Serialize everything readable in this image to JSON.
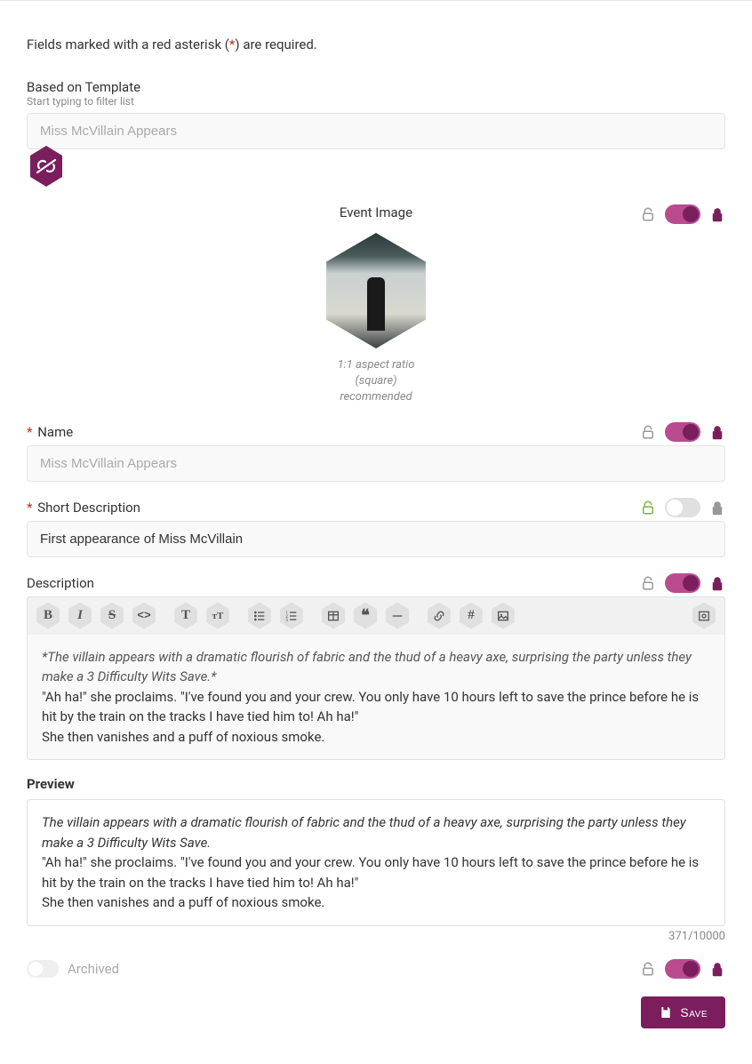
{
  "required_notice_pre": "Fields marked with a red asterisk (",
  "required_notice_mark": "*",
  "required_notice_post": ") are required.",
  "template": {
    "label": "Based on Template",
    "sublabel": "Start typing to filter list",
    "value": "Miss McVillain Appears"
  },
  "image": {
    "label": "Event Image",
    "hint_line1": "1:1 aspect ratio",
    "hint_line2": "(square)",
    "hint_line3": "recommended"
  },
  "name": {
    "label": "Name",
    "placeholder": "Miss McVillain Appears",
    "value": ""
  },
  "short_description": {
    "label": "Short Description",
    "value": "First appearance of Miss McVillain"
  },
  "description": {
    "label": "Description",
    "body_italic": "*The villain appears with a dramatic flourish of fabric and the thud of a heavy axe, surprising the party unless they make a 3 Difficulty Wits Save.*",
    "body_line2": "\"Ah ha!\" she proclaims. \"I've found you and your crew. You only have 10 hours left to save the prince before he is hit by the train on the tracks I have tied him to! Ah ha!\"",
    "body_line3": "She then vanishes and a puff of noxious smoke.",
    "preview_title": "Preview",
    "preview_italic": "The villain appears with a dramatic flourish of fabric and the thud of a heavy axe, surprising the party unless they make a 3 Difficulty Wits Save.",
    "preview_line2": "\"Ah ha!\" she proclaims. \"I've found you and your crew. You only have 10 hours left to save the prince before he is hit by the train on the tracks I have tied him to! Ah ha!\"",
    "preview_line3": "She then vanishes and a puff of noxious smoke.",
    "char_count": "371/10000"
  },
  "archived": {
    "label": "Archived"
  },
  "save_label": "Save"
}
